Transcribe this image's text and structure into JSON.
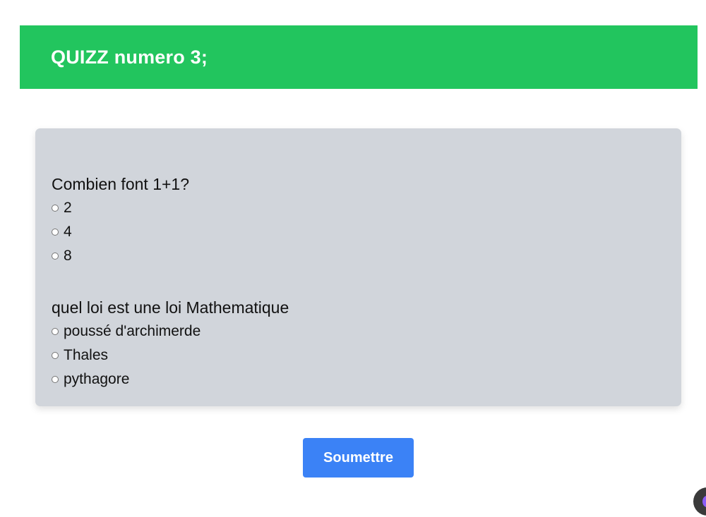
{
  "header": {
    "title": "QUIZZ numero 3;"
  },
  "quiz": {
    "questions": [
      {
        "text": "Combien font 1+1?",
        "options": [
          "2",
          "4",
          "8"
        ]
      },
      {
        "text": "quel loi est une loi Mathematique",
        "options": [
          "poussé d'archimerde",
          "Thales",
          "pythagore"
        ]
      }
    ]
  },
  "actions": {
    "submit_label": "Soumettre"
  },
  "colors": {
    "header_bg": "#22c55e",
    "card_bg": "#d1d5db",
    "button_bg": "#3b82f6"
  },
  "icons": {
    "corner_widget": "floating-assistant-icon"
  }
}
